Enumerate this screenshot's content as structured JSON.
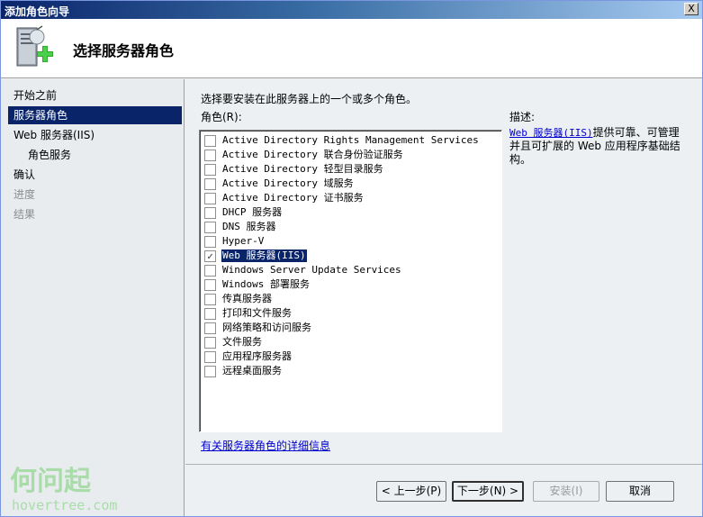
{
  "window": {
    "title": "添加角色向导",
    "close_glyph": "X"
  },
  "header": {
    "title": "选择服务器角色",
    "icon": "server-add-icon"
  },
  "nav": {
    "items": [
      {
        "label": "开始之前",
        "state": "normal",
        "level": 0
      },
      {
        "label": "服务器角色",
        "state": "selected",
        "level": 0
      },
      {
        "label": "Web 服务器(IIS)",
        "state": "normal",
        "level": 0
      },
      {
        "label": "角色服务",
        "state": "normal",
        "level": 1
      },
      {
        "label": "确认",
        "state": "normal",
        "level": 0
      },
      {
        "label": "进度",
        "state": "disabled",
        "level": 0
      },
      {
        "label": "结果",
        "state": "disabled",
        "level": 0
      }
    ]
  },
  "content": {
    "instruction": "选择要安装在此服务器上的一个或多个角色。",
    "roles_label": "角色(R):",
    "roles": [
      {
        "label": "Active Directory Rights Management Services",
        "checked": false
      },
      {
        "label": "Active Directory 联合身份验证服务",
        "checked": false
      },
      {
        "label": "Active Directory 轻型目录服务",
        "checked": false
      },
      {
        "label": "Active Directory 域服务",
        "checked": false
      },
      {
        "label": "Active Directory 证书服务",
        "checked": false
      },
      {
        "label": "DHCP 服务器",
        "checked": false
      },
      {
        "label": "DNS 服务器",
        "checked": false
      },
      {
        "label": "Hyper-V",
        "checked": false
      },
      {
        "label": "Web 服务器(IIS)",
        "checked": true,
        "selected": true
      },
      {
        "label": "Windows Server Update Services",
        "checked": false
      },
      {
        "label": "Windows 部署服务",
        "checked": false
      },
      {
        "label": "传真服务器",
        "checked": false
      },
      {
        "label": "打印和文件服务",
        "checked": false
      },
      {
        "label": "网络策略和访问服务",
        "checked": false
      },
      {
        "label": "文件服务",
        "checked": false
      },
      {
        "label": "应用程序服务器",
        "checked": false
      },
      {
        "label": "远程桌面服务",
        "checked": false
      }
    ],
    "more_info_link": "有关服务器角色的详细信息",
    "description_label": "描述:",
    "description_link": "Web 服务器(IIS)",
    "description_text": "提供可靠、可管理并且可扩展的 Web 应用程序基础结构。"
  },
  "footer": {
    "back_label": "< 上一步(P)",
    "next_label": "下一步(N) >",
    "install_label": "安装(I)",
    "cancel_label": "取消"
  },
  "watermark": {
    "text": "何问起",
    "url_text": "hovertree.com",
    "color": "#9fd49f"
  },
  "colors": {
    "selection": "#0a246a",
    "link": "#0000cc",
    "disabled": "#8c8c8c"
  }
}
